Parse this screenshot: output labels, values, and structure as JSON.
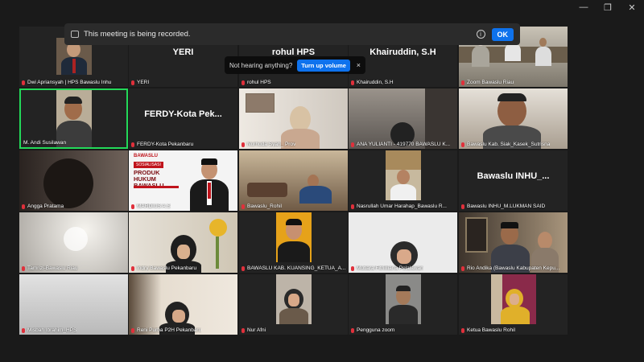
{
  "banner": {
    "text": "This meeting is being recorded.",
    "ok_label": "OK"
  },
  "toast": {
    "text": "Not hearing anything?",
    "button_label": "Turn up volume",
    "close_glyph": "×"
  },
  "window_controls": {
    "minimize": "—",
    "maximize": "❐",
    "close": "✕"
  },
  "name_cards": {
    "yeri": "YERI",
    "rohul": "rohul HPS",
    "khairuddin": "Khairuddin, S.H",
    "ferdy": "FERDY-Kota Pek...",
    "inhu": "Bawaslu INHU_..."
  },
  "poster": {
    "org": "BAWASLU",
    "badge": "SOSIALISASI",
    "title": "PRODUK HUKUM BAWASLU"
  },
  "participants": [
    "Dwi Apriansyah | HPS Bawaslu Inhu",
    "YERI",
    "rohul HPS",
    "Khairuddin, S.H",
    "Zoom Bawaslu Riau",
    "M. Andi Susilawan",
    "FERDY-Kota Pekanbaru",
    "Nurhuda Syah_ Prov",
    "ANA YULIANTI - 419770 BAWASLU K...",
    "Bawaslu Kab. Siak_Kasek_Sutrisna",
    "Angga Pratama",
    "MARDIUS A.S",
    "Bawaslu_Rohil",
    "Nasrullah Umar Harahap_Bawaslu R...",
    "Bawaslu INHU_M.LUKMAN SAID",
    "Tamrizi-Bawaslu Riau",
    "Indry Bawaslu Pekanbaru",
    "BAWASLU KAB. KUANSING_KETUA_A...",
    "Mutiara Fitriilliana Pelalawan",
    "Rio Andika (Bawaslu Kabupaten Kepu...",
    "Misbah Ibrahim_HPS",
    "Reni Purba P2H Pekanbaru",
    "Nur Afni",
    "Pengguna zoom",
    "Ketua Bawaslu Rohil"
  ]
}
